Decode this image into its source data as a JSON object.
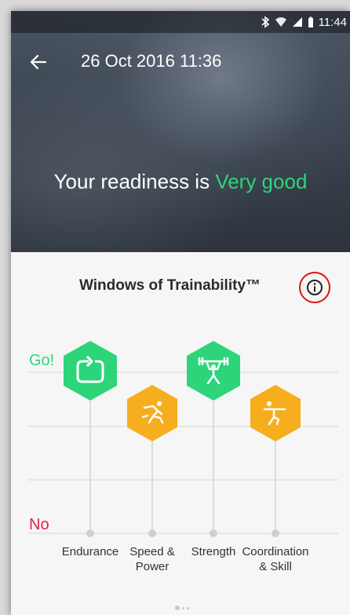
{
  "status_bar": {
    "time": "11:44"
  },
  "header": {
    "date_title": "26 Oct 2016 11:36"
  },
  "readiness": {
    "prefix": "Your readiness is ",
    "value": "Very good"
  },
  "windows": {
    "title": "Windows of Trainability™",
    "scale_top": "Go!",
    "scale_bottom": "No",
    "categories": [
      {
        "label": "Endurance",
        "level": "Go!",
        "color": "#2ed47a",
        "icon": "refresh-icon"
      },
      {
        "label": "Speed &\nPower",
        "level": "mid",
        "color": "#f6ae1f",
        "icon": "sprinter-icon"
      },
      {
        "label": "Strength",
        "level": "Go!",
        "color": "#2ed47a",
        "icon": "weightlifter-icon"
      },
      {
        "label": "Coordination\n& Skill",
        "level": "mid",
        "color": "#f6ae1f",
        "icon": "balance-icon"
      }
    ]
  },
  "colors": {
    "go": "#2ed47a",
    "no": "#e0234a",
    "mid": "#f6ae1f",
    "accent_highlight": "#e01212"
  }
}
